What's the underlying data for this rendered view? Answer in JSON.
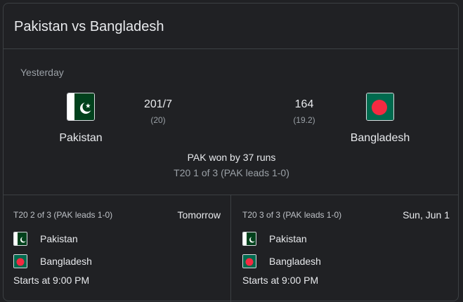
{
  "card": {
    "title": "Pakistan vs Bangladesh"
  },
  "match": {
    "date": "Yesterday",
    "team1": {
      "name": "Pakistan",
      "score": "201/7",
      "overs": "(20)",
      "flag_icon": "pakistan-flag-icon"
    },
    "team2": {
      "name": "Bangladesh",
      "score": "164",
      "overs": "(19.2)",
      "flag_icon": "bangladesh-flag-icon"
    },
    "result": "PAK won by 37 runs",
    "series": "T20 1 of 3 (PAK leads 1-0)"
  },
  "upcoming": [
    {
      "series": "T20 2 of 3 (PAK leads 1-0)",
      "date": "Tomorrow",
      "team1": "Pakistan",
      "team2": "Bangladesh",
      "start": "Starts at 9:00 PM"
    },
    {
      "series": "T20 3 of 3 (PAK leads 1-0)",
      "date": "Sun, Jun 1",
      "team1": "Pakistan",
      "team2": "Bangladesh",
      "start": "Starts at 9:00 PM"
    }
  ],
  "colors": {
    "background": "#202124",
    "border": "#3c4043",
    "text_primary": "#e8eaed",
    "text_secondary": "#9aa0a6",
    "pakistan_green": "#01411c",
    "bangladesh_green": "#006a4e",
    "bangladesh_red": "#f42a41"
  }
}
